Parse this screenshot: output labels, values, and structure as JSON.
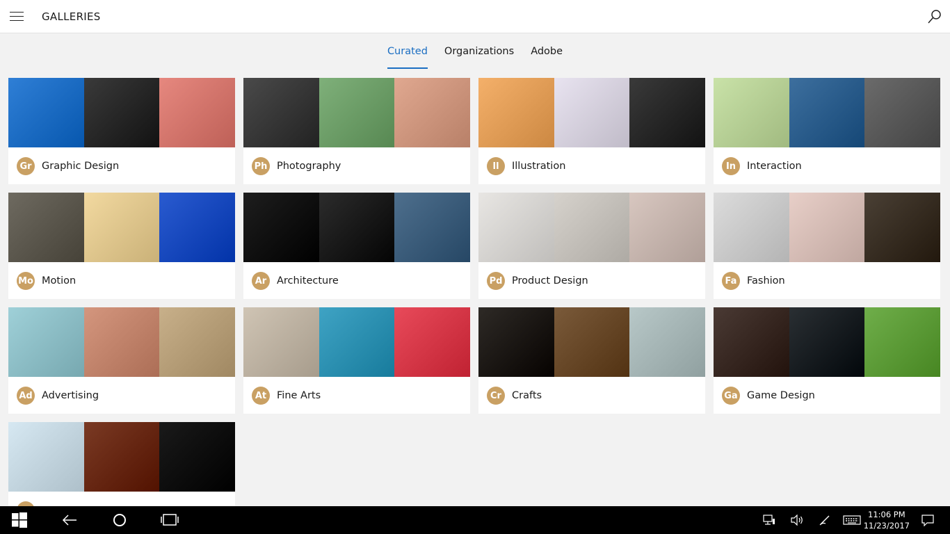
{
  "header": {
    "title": "GALLERIES"
  },
  "tabs": [
    {
      "label": "Curated",
      "active": true
    },
    {
      "label": "Organizations",
      "active": false
    },
    {
      "label": "Adobe",
      "active": false
    }
  ],
  "accent": "#1b6ec2",
  "badge_color": "#c9a063",
  "galleries": [
    {
      "abbr": "Gr",
      "name": "Graphic Design"
    },
    {
      "abbr": "Ph",
      "name": "Photography"
    },
    {
      "abbr": "Il",
      "name": "Illustration"
    },
    {
      "abbr": "In",
      "name": "Interaction"
    },
    {
      "abbr": "Mo",
      "name": "Motion"
    },
    {
      "abbr": "Ar",
      "name": "Architecture"
    },
    {
      "abbr": "Pd",
      "name": "Product Design"
    },
    {
      "abbr": "Fa",
      "name": "Fashion"
    },
    {
      "abbr": "Ad",
      "name": "Advertising"
    },
    {
      "abbr": "At",
      "name": "Fine Arts"
    },
    {
      "abbr": "Cr",
      "name": "Crafts"
    },
    {
      "abbr": "Ga",
      "name": "Game Design"
    },
    {
      "abbr": "",
      "name": ""
    }
  ],
  "thumb_colors": [
    [
      "#2f7fd6",
      "#3a3a3a",
      "#e6887f"
    ],
    [
      "#4a4a4a",
      "#7fb07a",
      "#e0a890"
    ],
    [
      "#f4b06a",
      "#e8e3f0",
      "#3a3a3a"
    ],
    [
      "#c9e2a8",
      "#3d6f9e",
      "#6b6b6b"
    ],
    [
      "#6e6a60",
      "#f2d9a0",
      "#2a5bd0"
    ],
    [
      "#1e1e1e",
      "#2c2c2c",
      "#4e6f8d"
    ],
    [
      "#e8e6e3",
      "#d6d2cc",
      "#d8c7c0"
    ],
    [
      "#dcdcdc",
      "#e8cfc8",
      "#4a4035"
    ],
    [
      "#9fd0d8",
      "#d4967e",
      "#c8b08a"
    ],
    [
      "#cfc4b4",
      "#3fa3c4",
      "#e84a5a"
    ],
    [
      "#2e2a26",
      "#7a5a3a",
      "#b8c8c8"
    ],
    [
      "#4a3a34",
      "#2a2f33",
      "#6fae4a"
    ],
    [
      "#d6e8f2",
      "#7a3a24",
      "#1a1a1a"
    ]
  ],
  "taskbar": {
    "time": "11:06 PM",
    "date": "11/23/2017"
  }
}
